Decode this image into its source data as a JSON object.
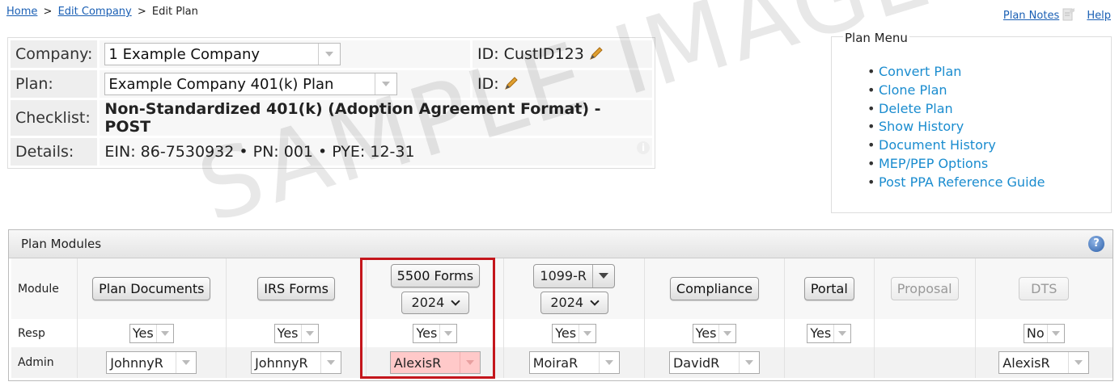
{
  "breadcrumb": {
    "home": "Home",
    "sep1": ">",
    "edit_company": "Edit Company",
    "sep2": ">",
    "current": "Edit Plan"
  },
  "top_links": {
    "plan_notes": "Plan Notes",
    "help": "Help"
  },
  "info": {
    "company_label": "Company:",
    "company_value": "1 Example Company",
    "company_id": "ID: CustID123",
    "plan_label": "Plan:",
    "plan_value": "Example Company 401(k) Plan",
    "plan_id": "ID:",
    "checklist_label": "Checklist:",
    "checklist_value": "Non-Standardized 401(k) (Adoption Agreement Format) - POST",
    "details_label": "Details:",
    "details_value": "EIN: 86-7530932 • PN: 001 • PYE: 12-31"
  },
  "plan_menu": {
    "title": "Plan Menu",
    "items": [
      "Convert Plan",
      "Clone Plan",
      "Delete Plan",
      "Show History",
      "Document History",
      "MEP/PEP Options",
      "Post PPA Reference Guide"
    ]
  },
  "watermark": "SAMPLE IMAGE",
  "modules": {
    "title": "Plan Modules",
    "row_labels": {
      "module": "Module",
      "resp": "Resp",
      "admin": "Admin"
    },
    "plan_documents": {
      "label": "Plan Documents",
      "resp": "Yes",
      "admin": "JohnnyR"
    },
    "irs_forms": {
      "label": "IRS Forms",
      "resp": "Yes",
      "admin": "JohnnyR"
    },
    "forms_5500": {
      "label": "5500 Forms",
      "year": "2024",
      "resp": "Yes",
      "admin": "AlexisR"
    },
    "forms_1099r": {
      "label": "1099-R",
      "year": "2024",
      "resp": "Yes",
      "admin": "MoiraR"
    },
    "compliance": {
      "label": "Compliance",
      "resp": "Yes",
      "admin": "DavidR"
    },
    "portal": {
      "label": "Portal",
      "resp": "Yes"
    },
    "proposal": {
      "label": "Proposal"
    },
    "dts": {
      "label": "DTS",
      "resp": "No",
      "admin": "AlexisR"
    }
  },
  "colors": {
    "link": "#1a5fb4",
    "menu_link": "#1a8ccf",
    "highlight_border": "#c4161c",
    "highlight_fill": "#ffc9c9"
  }
}
